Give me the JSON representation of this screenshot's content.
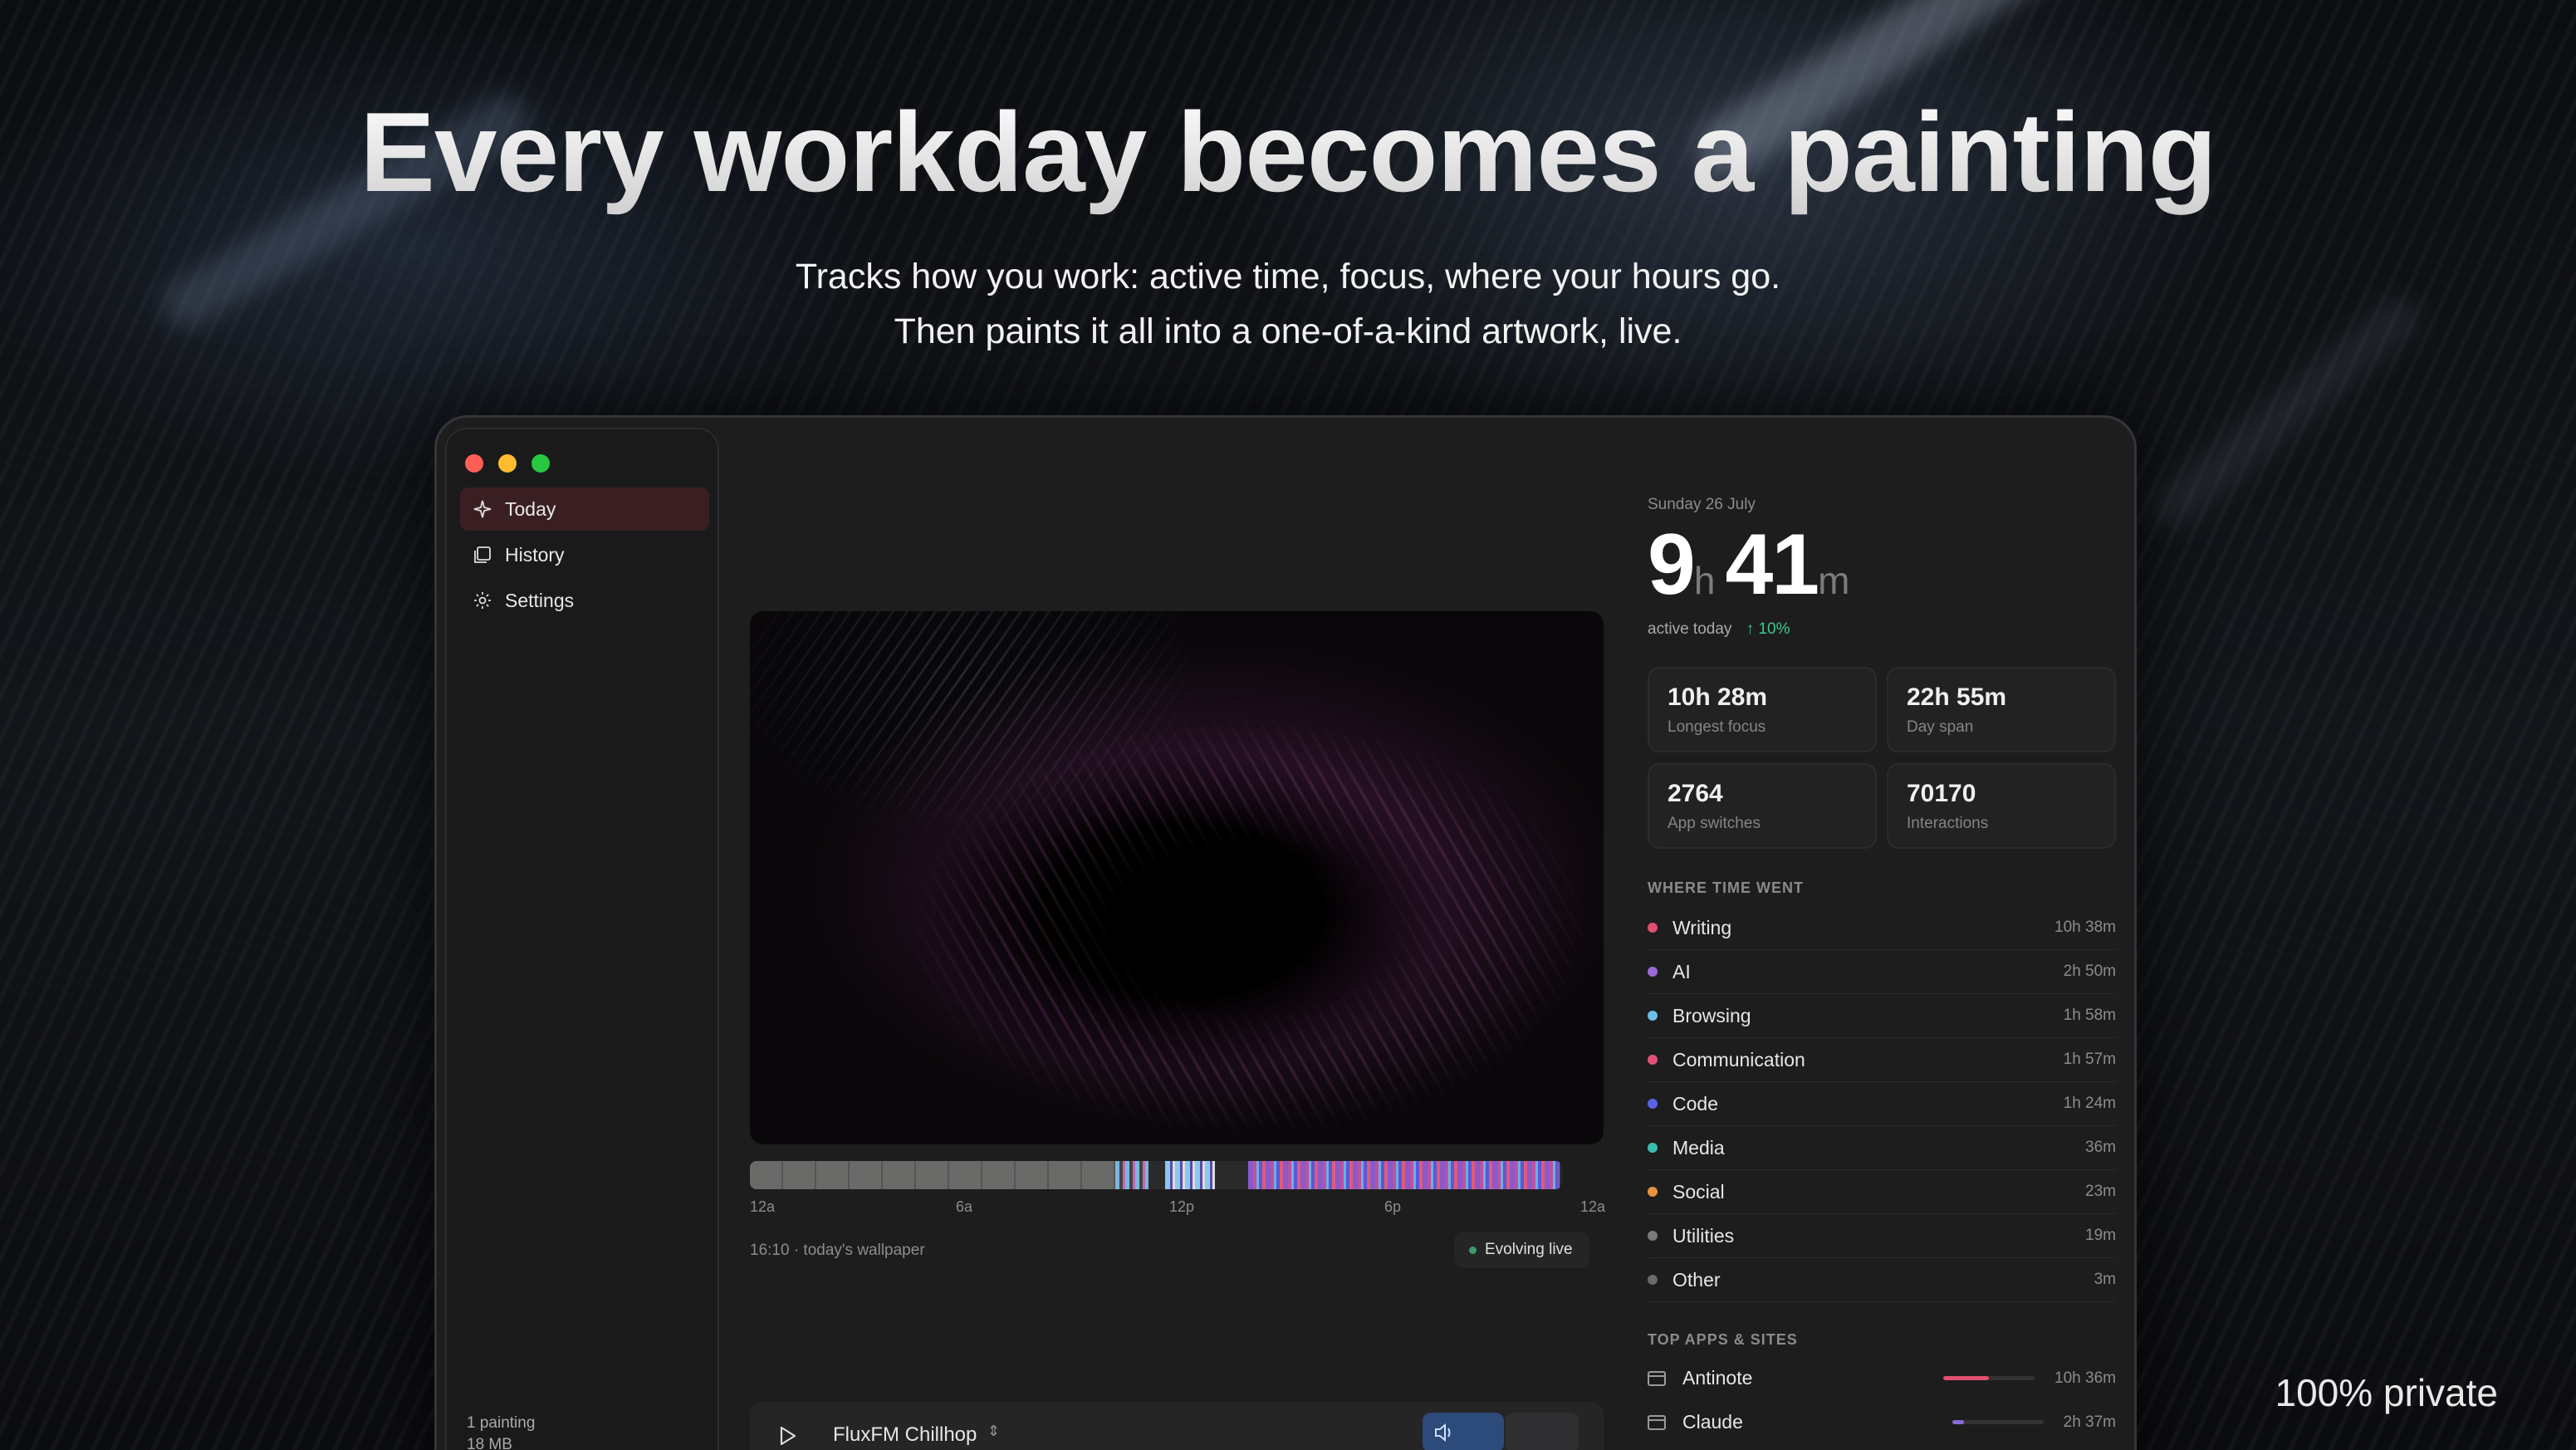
{
  "hero": {
    "title": "Every workday becomes a painting",
    "subtitle_line1": "Tracks how you work: active time, focus, where your hours go.",
    "subtitle_line2": "Then paints it all into a one-of-a-kind artwork, live."
  },
  "window": {
    "traffic_colors": [
      "#ff5f57",
      "#febc2e",
      "#28c840"
    ]
  },
  "sidebar": {
    "items": [
      {
        "label": "Today",
        "icon": "sparkle-icon",
        "active": true
      },
      {
        "label": "History",
        "icon": "gallery-icon",
        "active": false
      },
      {
        "label": "Settings",
        "icon": "gear-icon",
        "active": false
      }
    ],
    "footer_count": "1 painting",
    "footer_size": "18 MB"
  },
  "main": {
    "timeline_labels": [
      "12a",
      "6a",
      "12p",
      "6p",
      "12a"
    ],
    "wallpaper_caption": "16:10 · today's wallpaper",
    "evolving_label": "Evolving live",
    "player": {
      "station": "FluxFM Chillhop",
      "play_icon": "play-icon",
      "volume_icon": "speaker-icon"
    }
  },
  "stats": {
    "date": "Sunday 26 July",
    "hours": "9",
    "hours_unit": "h",
    "minutes": "41",
    "minutes_unit": "m",
    "active_label": "active today",
    "trend": "↑ 10%",
    "cards": [
      {
        "value": "10h 28m",
        "label": "Longest focus"
      },
      {
        "value": "22h 55m",
        "label": "Day span"
      },
      {
        "value": "2764",
        "label": "App switches"
      },
      {
        "value": "70170",
        "label": "Interactions"
      }
    ]
  },
  "where_time_went": {
    "heading": "WHERE TIME WENT",
    "categories": [
      {
        "name": "Writing",
        "time": "10h 38m",
        "color": "#e0506e"
      },
      {
        "name": "AI",
        "time": "2h 50m",
        "color": "#9a6ad8"
      },
      {
        "name": "Browsing",
        "time": "1h 58m",
        "color": "#6cc0e8"
      },
      {
        "name": "Communication",
        "time": "1h 57m",
        "color": "#e0507a"
      },
      {
        "name": "Code",
        "time": "1h 24m",
        "color": "#5a62e8"
      },
      {
        "name": "Media",
        "time": "36m",
        "color": "#3cbcb0"
      },
      {
        "name": "Social",
        "time": "23m",
        "color": "#e8923c"
      },
      {
        "name": "Utilities",
        "time": "19m",
        "color": "#7a7a7a"
      },
      {
        "name": "Other",
        "time": "3m",
        "color": "#6a6a6a"
      }
    ]
  },
  "top_apps": {
    "heading": "TOP APPS & SITES",
    "apps": [
      {
        "name": "Antinote",
        "time": "10h 36m",
        "share": 0.5,
        "color": "#e0506e"
      },
      {
        "name": "Claude",
        "time": "2h 37m",
        "share": 0.13,
        "color": "#8a6ad8"
      }
    ]
  },
  "badge": "100% private"
}
